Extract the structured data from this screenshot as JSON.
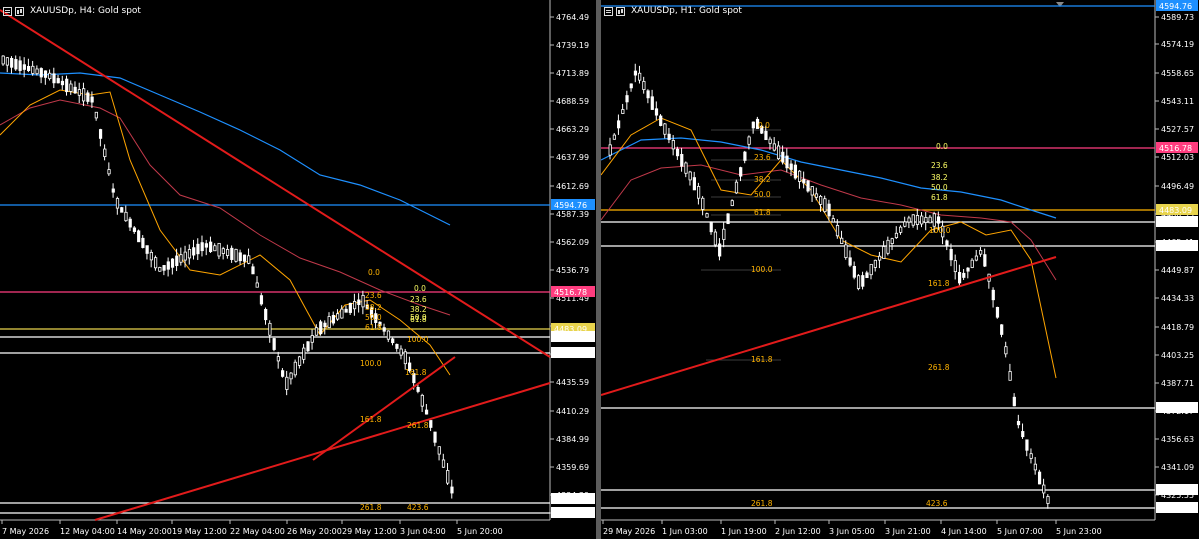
{
  "left": {
    "title": "XAUUSDp, H4:  Gold spot",
    "yticks": [
      "4764.49",
      "4739.19",
      "4713.89",
      "4688.59",
      "4663.29",
      "4637.99",
      "4612.69",
      "4587.39",
      "4562.09",
      "4536.79",
      "4511.49",
      "4486.19",
      "4460.89",
      "4435.59",
      "4410.29",
      "4384.99",
      "4359.69",
      "4334.39",
      "4318.49"
    ],
    "xticks": [
      "7 May 2026",
      "12 May 04:00",
      "14 May 20:00",
      "19 May 12:00",
      "22 May 04:00",
      "26 May 20:00",
      "29 May 12:00",
      "3 Jun 04:00",
      "5 Jun 20:00"
    ],
    "price_tags": [
      {
        "label": "4594.76",
        "color": "#1e90ff"
      },
      {
        "label": "4516.78",
        "color": "#ff3d7f"
      },
      {
        "label": "4483.09",
        "color": "#e8d44d"
      },
      {
        "label": "4476.26",
        "color": "#ffffff"
      },
      {
        "label": "4462.41",
        "color": "#ffffff"
      },
      {
        "label": "4326.40",
        "color": "#ffffff"
      },
      {
        "label": "4318.49",
        "color": "#ffffff"
      }
    ],
    "fib_a": [
      "0.0",
      "23.6",
      "38.2",
      "50.0",
      "61.8",
      "100.0",
      "161.8"
    ],
    "fib_b": [
      "0.0",
      "23.6",
      "38.2",
      "50.0",
      "61.8",
      "100.0",
      "161.8",
      "261.8"
    ],
    "ext_labels": [
      "261.8",
      "423.6"
    ]
  },
  "right": {
    "title": "XAUUSDp, H1:  Gold spot",
    "yticks": [
      "4589.73",
      "4574.19",
      "4558.65",
      "4543.11",
      "4527.57",
      "4512.03",
      "4496.49",
      "4480.95",
      "4465.41",
      "4449.87",
      "4434.33",
      "4418.79",
      "4403.25",
      "4387.71",
      "4372.17",
      "4356.63",
      "4341.09",
      "4325.55"
    ],
    "xticks": [
      "29 May 2026",
      "1 Jun 03:00",
      "1 Jun 19:00",
      "2 Jun 12:00",
      "3 Jun 05:00",
      "3 Jun 21:00",
      "4 Jun 14:00",
      "5 Jun 07:00",
      "5 Jun 23:00"
    ],
    "price_tags": [
      {
        "label": "4594.76",
        "color": "#1e90ff"
      },
      {
        "label": "4516.78",
        "color": "#ff3d7f"
      },
      {
        "label": "4483.09",
        "color": "#e8d44d"
      },
      {
        "label": "4476.26",
        "color": "#ffffff"
      },
      {
        "label": "4462.41",
        "color": "#ffffff"
      },
      {
        "label": "4373.63",
        "color": "#ffffff"
      },
      {
        "label": "4320.40",
        "color": "#ffffff"
      },
      {
        "label": "4318.49",
        "color": "#ffffff"
      }
    ],
    "fib_a": [
      "0.0",
      "23.6",
      "38.2",
      "50.0",
      "61.8",
      "100.0",
      "161.8"
    ],
    "fib_b": [
      "0.0",
      "23.6",
      "38.2",
      "50.0",
      "61.8",
      "100.0",
      "161.8",
      "261.8"
    ],
    "ext_labels": [
      "261.8",
      "423.6"
    ]
  },
  "colors": {
    "trendline": "#e21b1b",
    "ma_fast": "#ffa500",
    "ma_mid": "#c0394a",
    "ma_slow": "#1e90ff",
    "candle": "#ffffff",
    "fib": "#ffb300"
  }
}
